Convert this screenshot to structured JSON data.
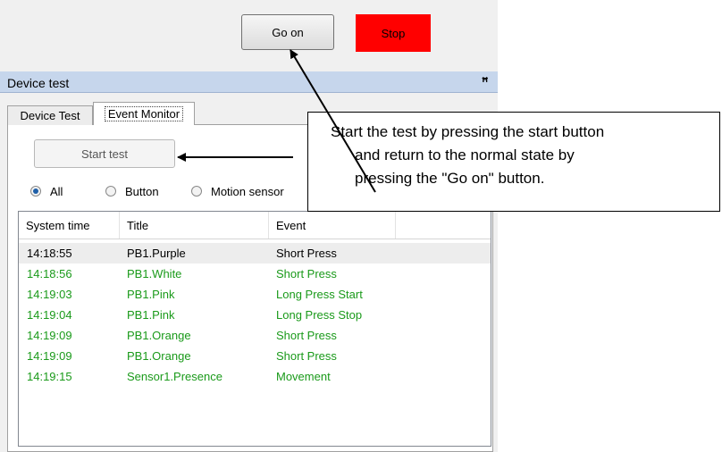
{
  "toolbar": {
    "go_on_label": "Go on",
    "stop_label": "Stop",
    "stop_color": "#ff0000"
  },
  "panel": {
    "title": "Device test",
    "pin_icon": "pin-icon"
  },
  "tabs": [
    {
      "label": "Device Test",
      "active": false
    },
    {
      "label": "Event Monitor",
      "active": true
    }
  ],
  "start_button_label": "Start test",
  "filters": [
    {
      "label": "All",
      "selected": true
    },
    {
      "label": "Button",
      "selected": false
    },
    {
      "label": "Motion sensor",
      "selected": false
    }
  ],
  "table": {
    "columns": [
      "System time",
      "Title",
      "Event"
    ],
    "rows": [
      {
        "time": "14:18:55",
        "title": "PB1.Purple",
        "event": "Short Press",
        "color": "#000000"
      },
      {
        "time": "14:18:56",
        "title": "PB1.White",
        "event": "Short Press",
        "color": "#1a9a1a"
      },
      {
        "time": "14:19:03",
        "title": "PB1.Pink",
        "event": "Long Press Start",
        "color": "#1a9a1a"
      },
      {
        "time": "14:19:04",
        "title": "PB1.Pink",
        "event": "Long Press Stop",
        "color": "#1a9a1a"
      },
      {
        "time": "14:19:09",
        "title": "PB1.Orange",
        "event": "Short Press",
        "color": "#1a9a1a"
      },
      {
        "time": "14:19:09",
        "title": "PB1.Orange",
        "event": "Short Press",
        "color": "#1a9a1a"
      },
      {
        "time": "14:19:15",
        "title": "Sensor1.Presence",
        "event": "Movement",
        "color": "#1a9a1a"
      }
    ]
  },
  "callout": {
    "lines": [
      "Start the test by pressing the start button",
      "and return to the normal state by",
      "pressing the \"Go on\" button."
    ]
  }
}
